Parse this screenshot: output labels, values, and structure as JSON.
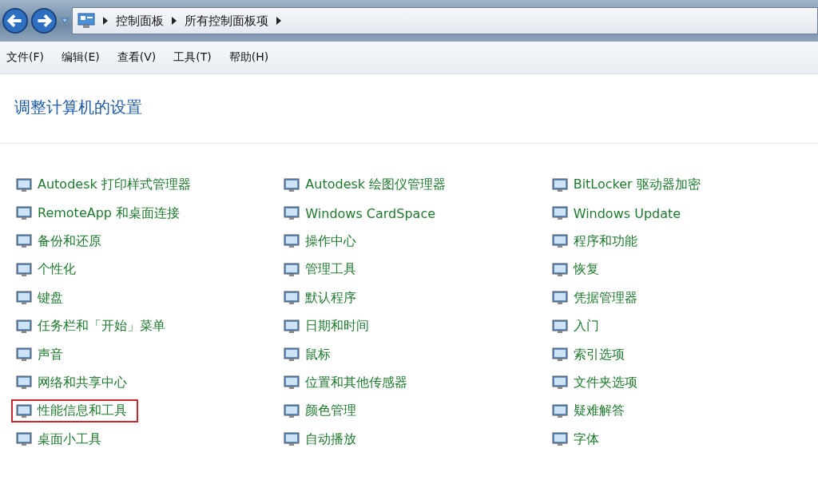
{
  "breadcrumb": [
    "控制面板",
    "所有控制面板项"
  ],
  "menu": [
    "文件(F)",
    "编辑(E)",
    "查看(V)",
    "工具(T)",
    "帮助(H)"
  ],
  "heading": "调整计算机的设置",
  "columns": [
    {
      "items": [
        {
          "label": "Autodesk 打印样式管理器",
          "highlighted": false
        },
        {
          "label": "RemoteApp 和桌面连接",
          "highlighted": false
        },
        {
          "label": "备份和还原",
          "highlighted": false
        },
        {
          "label": "个性化",
          "highlighted": false
        },
        {
          "label": "键盘",
          "highlighted": false
        },
        {
          "label": "任务栏和「开始」菜单",
          "highlighted": false
        },
        {
          "label": "声音",
          "highlighted": false
        },
        {
          "label": "网络和共享中心",
          "highlighted": false
        },
        {
          "label": "性能信息和工具",
          "highlighted": true
        },
        {
          "label": "桌面小工具",
          "highlighted": false
        }
      ]
    },
    {
      "items": [
        {
          "label": "Autodesk 绘图仪管理器",
          "highlighted": false
        },
        {
          "label": "Windows CardSpace",
          "highlighted": false
        },
        {
          "label": "操作中心",
          "highlighted": false
        },
        {
          "label": "管理工具",
          "highlighted": false
        },
        {
          "label": "默认程序",
          "highlighted": false
        },
        {
          "label": "日期和时间",
          "highlighted": false
        },
        {
          "label": "鼠标",
          "highlighted": false
        },
        {
          "label": "位置和其他传感器",
          "highlighted": false
        },
        {
          "label": "颜色管理",
          "highlighted": false
        },
        {
          "label": "自动播放",
          "highlighted": false
        }
      ]
    },
    {
      "items": [
        {
          "label": "BitLocker 驱动器加密",
          "highlighted": false
        },
        {
          "label": "Windows Update",
          "highlighted": false
        },
        {
          "label": "程序和功能",
          "highlighted": false
        },
        {
          "label": "恢复",
          "highlighted": false
        },
        {
          "label": "凭据管理器",
          "highlighted": false
        },
        {
          "label": "入门",
          "highlighted": false
        },
        {
          "label": "索引选项",
          "highlighted": false
        },
        {
          "label": "文件夹选项",
          "highlighted": false
        },
        {
          "label": "疑难解答",
          "highlighted": false
        },
        {
          "label": "字体",
          "highlighted": false
        }
      ]
    }
  ]
}
